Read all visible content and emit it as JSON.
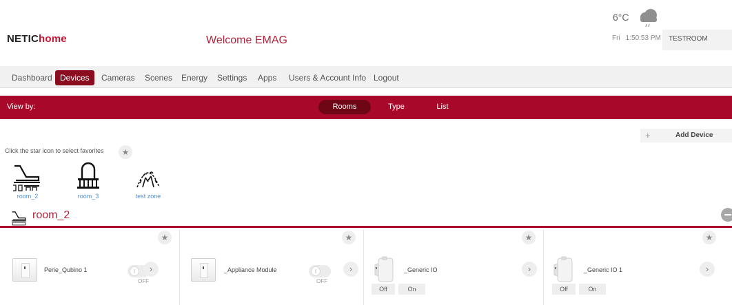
{
  "brand": {
    "part1": "NETIC",
    "part2": "home"
  },
  "welcome": "Welcome EMAG",
  "weather": {
    "temperature": "6°C",
    "day": "Fri",
    "time": "1:50:53 PM",
    "room": "TESTROOM",
    "icon": "rain-cloud-icon"
  },
  "nav": [
    "Dashboard",
    "Devices",
    "Cameras",
    "Scenes",
    "Energy",
    "Settings",
    "Apps",
    "Users & Account Info",
    "Logout"
  ],
  "nav_active": "Devices",
  "viewbar": {
    "label": "View by:",
    "options": [
      "Rooms",
      "Type",
      "List"
    ],
    "active": "Rooms"
  },
  "add_device": {
    "icon": "+",
    "label": "Add Device"
  },
  "favorites_hint": "Click the star icon to select favorites",
  "rooms": [
    {
      "label": "room_2",
      "icon": "room-lounge-icon"
    },
    {
      "label": "room_3",
      "icon": "room-gate-icon"
    },
    {
      "label": "test zone",
      "icon": "zone-garden-icon"
    }
  ],
  "section": {
    "title": "room_2"
  },
  "devices": [
    {
      "name": "Perie_Qubino 1",
      "kind": "switch",
      "state_label": "OFF"
    },
    {
      "name": "_Appliance Module",
      "kind": "switch",
      "state_label": "OFF"
    },
    {
      "name": "_Generic IO",
      "kind": "io",
      "off_label": "Off",
      "on_label": "On"
    },
    {
      "name": "_Generic IO 1",
      "kind": "io",
      "off_label": "Off",
      "on_label": "On"
    }
  ],
  "icons": {
    "star": "★",
    "chevron": "›"
  },
  "colors": {
    "accent": "#a8082a",
    "nav_active": "#8b0b1f",
    "brand_red": "#c41230",
    "link_blue": "#4f8fd2"
  }
}
